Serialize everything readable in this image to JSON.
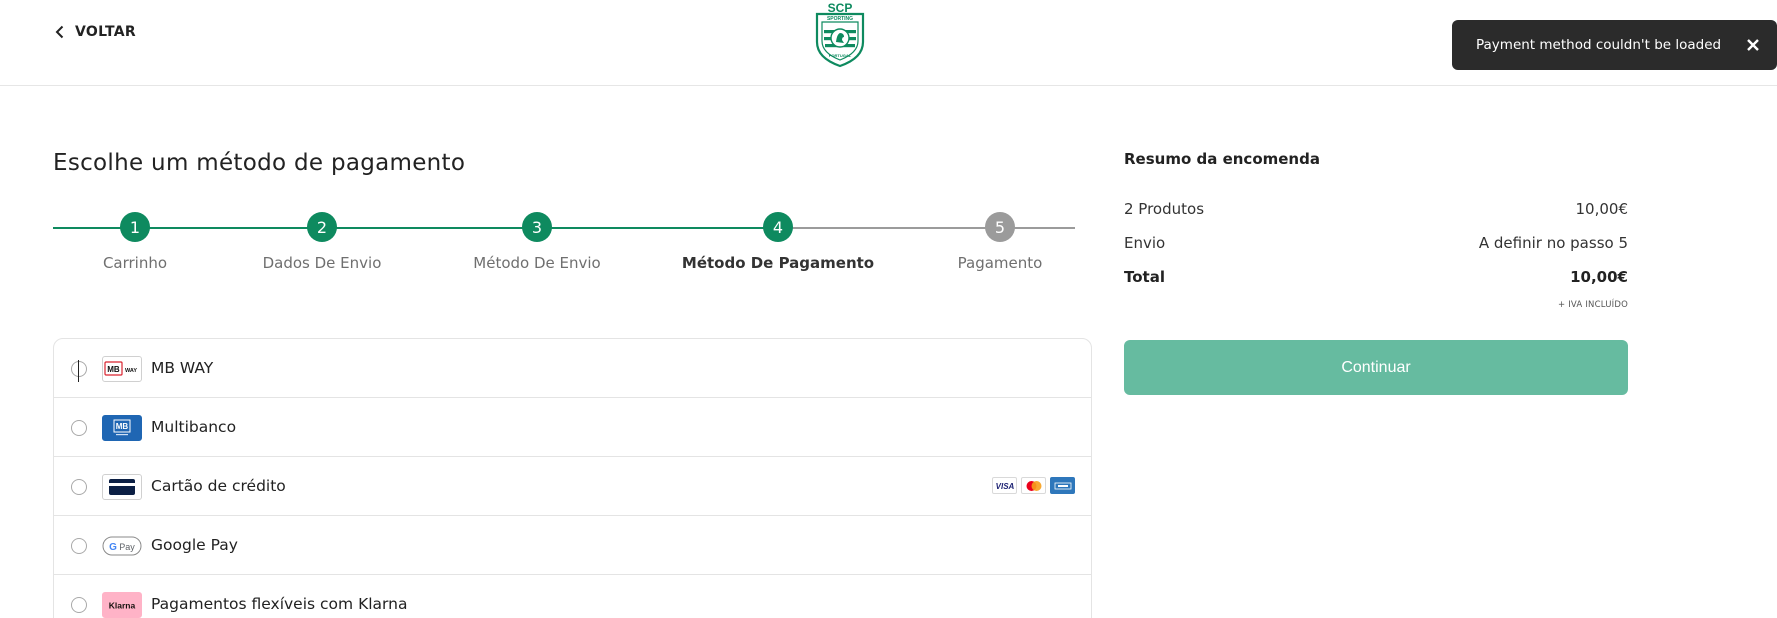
{
  "header": {
    "back_label": "VOLTAR",
    "logo_icon": "sporting-cp-crest-icon",
    "logo_text": "SCP",
    "logo_ring_top": "SPORTING",
    "logo_ring_bottom": "PORTUGAL"
  },
  "toast": {
    "message": "Payment method couldn't be loaded",
    "close_icon": "close-icon"
  },
  "page": {
    "title": "Escolhe um método de pagamento"
  },
  "stepper": {
    "steps": [
      {
        "number": "1",
        "label": "Carrinho",
        "state": "done"
      },
      {
        "number": "2",
        "label": "Dados De Envio",
        "state": "done"
      },
      {
        "number": "3",
        "label": "Método De Envio",
        "state": "done"
      },
      {
        "number": "4",
        "label": "Método De Pagamento",
        "state": "active"
      },
      {
        "number": "5",
        "label": "Pagamento",
        "state": "pending"
      }
    ],
    "active_color": "#0e8a5f",
    "pending_color": "#9b9b9b"
  },
  "payment_methods": [
    {
      "label": "MB WAY",
      "icon": "mbway-icon"
    },
    {
      "label": "Multibanco",
      "icon": "multibanco-icon"
    },
    {
      "label": "Cartão de crédito",
      "icon": "credit-card-icon",
      "card_brands": [
        "visa-icon",
        "mastercard-icon",
        "amex-icon"
      ]
    },
    {
      "label": "Google Pay",
      "icon": "google-pay-icon"
    },
    {
      "label": "Pagamentos flexíveis com Klarna",
      "icon": "klarna-icon"
    }
  ],
  "summary": {
    "title": "Resumo da encomenda",
    "rows": [
      {
        "label": "2 Produtos",
        "value": "10,00€"
      },
      {
        "label": "Envio",
        "value": "A definir no passo 5"
      },
      {
        "label": "Total",
        "value": "10,00€"
      }
    ],
    "vat_note": "+ IVA INCLUÍDO",
    "continue_label": "Continuar",
    "continue_color": "#66bba0"
  }
}
